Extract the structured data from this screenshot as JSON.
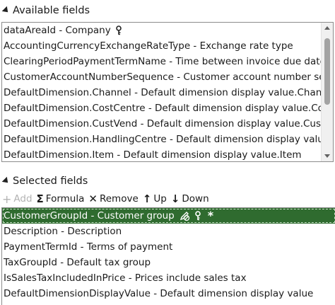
{
  "available": {
    "header": "Available fields",
    "rows": [
      "dataAreaId - Company",
      "AccountingCurrencyExchangeRateType - Exchange rate type",
      "ClearingPeriodPaymentTermName - Time between invoice due date a",
      "CustomerAccountNumberSequence - Customer account number seq",
      "DefaultDimension.Channel - Default dimension display value.Channe",
      "DefaultDimension.CostCentre - Default dimension display value.CostC",
      "DefaultDimension.CustVend - Default dimension display value.CustVe",
      "DefaultDimension.HandlingCentre - Default dimension display value.",
      "DefaultDimension.Item - Default dimension display value.Item"
    ]
  },
  "toolbar": {
    "add_label": "Add",
    "formula_label": "Formula",
    "remove_label": "Remove",
    "up_label": "Up",
    "down_label": "Down"
  },
  "selected": {
    "header": "Selected fields",
    "rows": [
      "CustomerGroupId - Customer group",
      "Description - Description",
      "PaymentTermId - Terms of payment",
      "TaxGroupId - Default tax group",
      "IsSalesTaxIncludedInPrice - Prices include sales tax",
      "DefaultDimensionDisplayValue - Default dimension display value"
    ],
    "selected_row_marker": "*"
  },
  "colors": {
    "selected_row_bg": "#2f6b2f",
    "disabled_text": "#b3b3b3",
    "border": "#8c8c8c"
  },
  "icons": {
    "key": "key-icon",
    "mandatory": "asterisk-icon",
    "edit": "pen-no-edit-icon"
  }
}
